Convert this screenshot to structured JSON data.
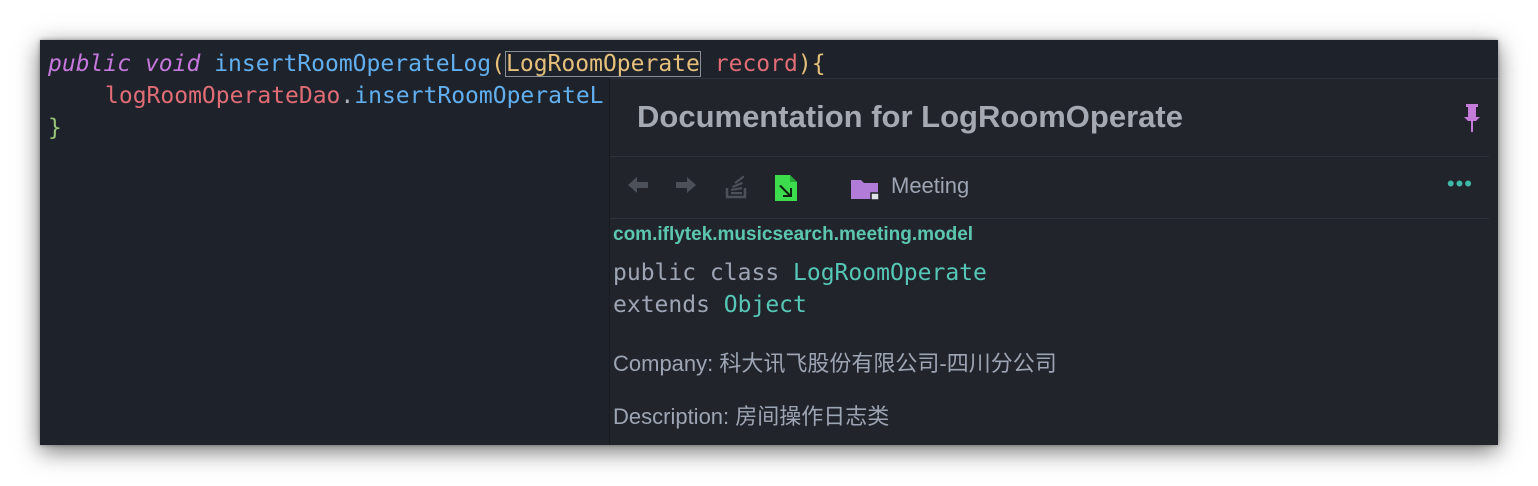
{
  "code": {
    "kw_public": "public",
    "kw_void": "void",
    "method_name": "insertRoomOperateLog",
    "open_paren": "(",
    "param_type": "LogRoomOperate",
    "param_name": "record",
    "close_brace_open": "){",
    "line2_field": "logRoomOperateDao",
    "line2_dot": ".",
    "line2_call": "insertRoomOperateL",
    "close_brace": "}"
  },
  "doc": {
    "title": "Documentation for LogRoomOperate",
    "location": "Meeting",
    "more": "•••",
    "package": "com.iflytek.musicsearch.meeting.model",
    "decl_public_class": "public class ",
    "decl_class_name": "LogRoomOperate",
    "decl_extends": "extends ",
    "decl_super": "Object",
    "company_text": "Company: 科大讯飞股份有限公司-四川分公司",
    "description_text": "Description: 房间操作日志类"
  },
  "colors": {
    "editor_bg": "#1e222b",
    "keyword": "#c678dd",
    "function": "#61afef",
    "type": "#e5c07b",
    "param": "#e06c75",
    "teal": "#56c7b6",
    "icon_green": "#3ddc4c",
    "folder_purple": "#b07cd8"
  },
  "icons": [
    "arrow-left-icon",
    "arrow-right-icon",
    "stack-overflow-icon",
    "external-doc-icon",
    "folder-icon",
    "pin-icon",
    "more-icon"
  ]
}
